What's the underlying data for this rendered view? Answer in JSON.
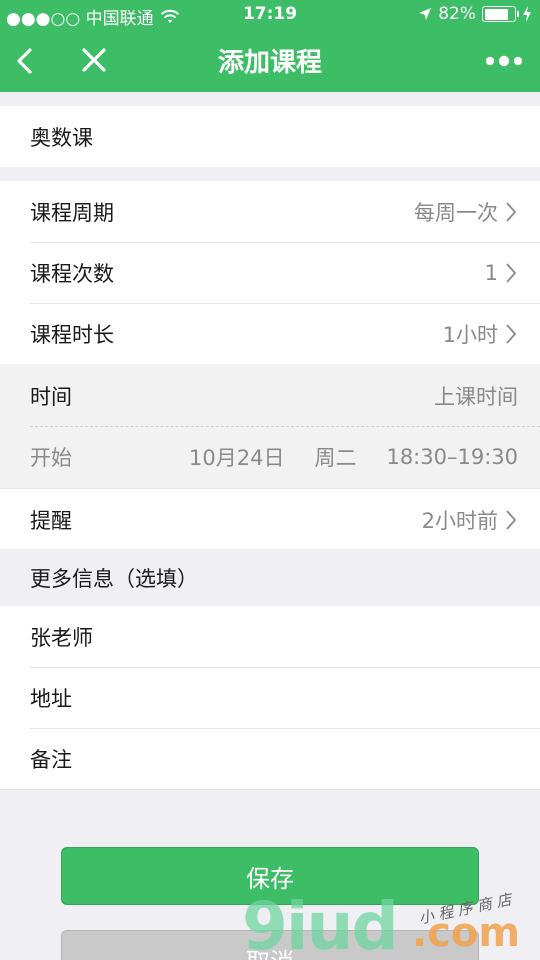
{
  "status_bar": {
    "carrier": "●●●○○ 中国联通",
    "time": "17:19",
    "battery_text": "82%",
    "battery_level": 0.82
  },
  "nav": {
    "title": "添加课程",
    "back_icon": "chevron-left-icon",
    "close_icon": "close-icon",
    "more_icon": "more-dots-icon"
  },
  "course": {
    "name_value": "奥数课"
  },
  "settings": [
    {
      "label": "课程周期",
      "value": "每周一次"
    },
    {
      "label": "课程次数",
      "value": "1"
    },
    {
      "label": "课程时长",
      "value": "1小时"
    }
  ],
  "time": {
    "label": "时间",
    "value": "上课时间",
    "start_label": "开始",
    "start_date": "10月24日",
    "start_weekday": "周二",
    "start_range": "18:30–19:30"
  },
  "reminder": {
    "label": "提醒",
    "value": "2小时前"
  },
  "more_info": {
    "title": "更多信息（选填）",
    "teacher_value": "张老师",
    "address_placeholder": "地址",
    "note_placeholder": "备注"
  },
  "buttons": {
    "save_label": "保存",
    "cancel_label": "取消"
  },
  "watermark": {
    "brand": "9iud",
    "suffix": ".com",
    "tagline": "小 程 序 商 店"
  },
  "colors": {
    "accent": "#3dbd66",
    "muted_text": "#8a8a8a"
  }
}
